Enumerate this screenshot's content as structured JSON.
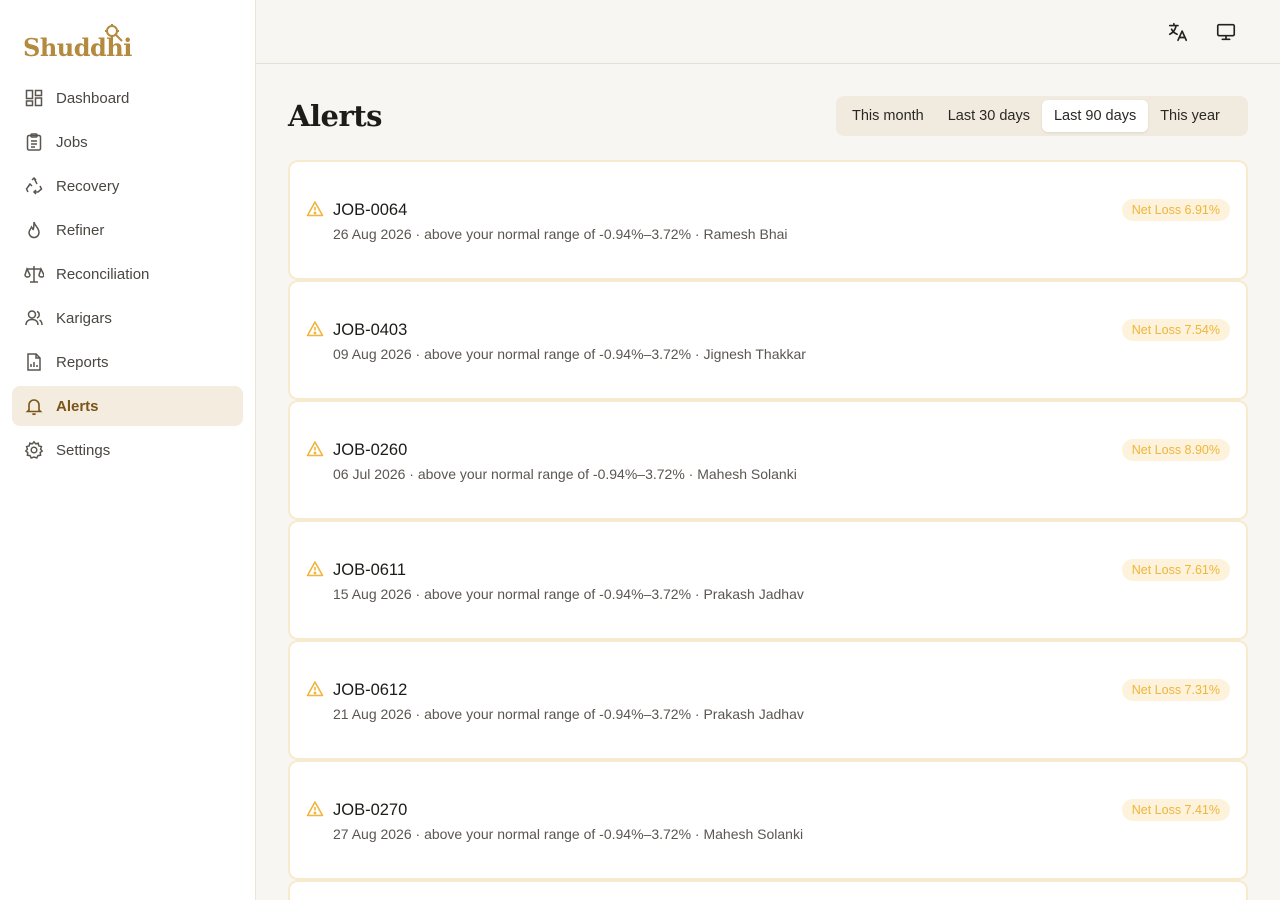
{
  "app": {
    "logo_text": "Shuddhi"
  },
  "sidebar": {
    "items": [
      {
        "label": "Dashboard",
        "icon": "dashboard-icon",
        "active": false
      },
      {
        "label": "Jobs",
        "icon": "clipboard-icon",
        "active": false
      },
      {
        "label": "Recovery",
        "icon": "recycle-icon",
        "active": false
      },
      {
        "label": "Refiner",
        "icon": "flame-icon",
        "active": false
      },
      {
        "label": "Reconciliation",
        "icon": "scale-icon",
        "active": false
      },
      {
        "label": "Karigars",
        "icon": "users-icon",
        "active": false
      },
      {
        "label": "Reports",
        "icon": "report-icon",
        "active": false
      },
      {
        "label": "Alerts",
        "icon": "bell-icon",
        "active": true
      },
      {
        "label": "Settings",
        "icon": "gear-icon",
        "active": false
      }
    ]
  },
  "topbar": {
    "icons": [
      "translate-icon",
      "monitor-icon"
    ]
  },
  "page": {
    "title": "Alerts"
  },
  "range": {
    "options": [
      "This month",
      "Last 30 days",
      "Last 90 days",
      "This year"
    ],
    "selected": "Last 90 days"
  },
  "alerts": [
    {
      "job": "JOB-0064",
      "meta": "26 Aug 2026 · above your normal range of -0.94%–3.72% · Ramesh Bhai",
      "badge": "Net Loss 6.91%"
    },
    {
      "job": "JOB-0403",
      "meta": "09 Aug 2026 · above your normal range of -0.94%–3.72% · Jignesh Thakkar",
      "badge": "Net Loss 7.54%"
    },
    {
      "job": "JOB-0260",
      "meta": "06 Jul 2026 · above your normal range of -0.94%–3.72% · Mahesh Solanki",
      "badge": "Net Loss 8.90%"
    },
    {
      "job": "JOB-0611",
      "meta": "15 Aug 2026 · above your normal range of -0.94%–3.72% · Prakash Jadhav",
      "badge": "Net Loss 7.61%"
    },
    {
      "job": "JOB-0612",
      "meta": "21 Aug 2026 · above your normal range of -0.94%–3.72% · Prakash Jadhav",
      "badge": "Net Loss 7.31%"
    },
    {
      "job": "JOB-0270",
      "meta": "27 Aug 2026 · above your normal range of -0.94%–3.72% · Mahesh Solanki",
      "badge": "Net Loss 7.41%"
    }
  ],
  "colors": {
    "brand": "#b38a3e",
    "active_bg": "#f5ece0",
    "warning": "#f0b53a",
    "badge_bg": "#fdf3dc"
  }
}
